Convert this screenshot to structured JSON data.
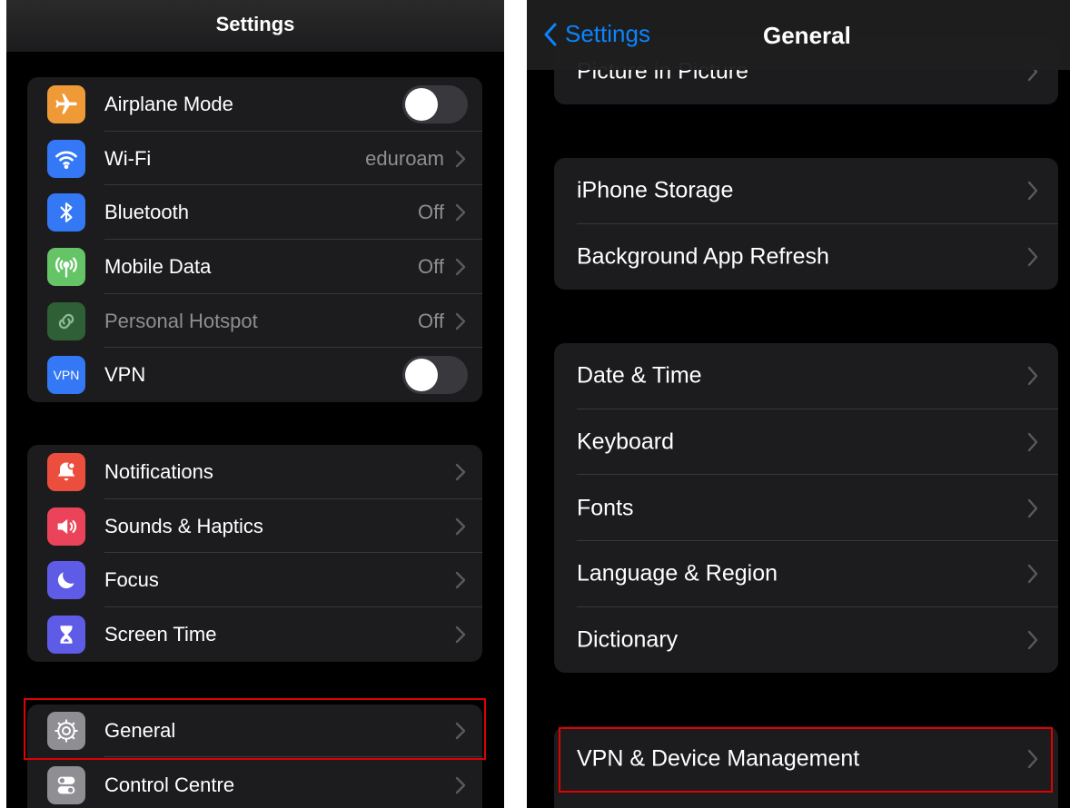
{
  "left_screen": {
    "nav": {
      "title": "Settings"
    },
    "group1": [
      {
        "label": "Airplane Mode",
        "icon": "airplane-icon",
        "icon_color": "#f09a37",
        "control": "toggle",
        "toggle_on": false
      },
      {
        "label": "Wi-Fi",
        "value": "eduroam",
        "icon": "wifi-icon",
        "icon_color": "#3478f6",
        "control": "chevron"
      },
      {
        "label": "Bluetooth",
        "value": "Off",
        "icon": "bluetooth-icon",
        "icon_color": "#3478f6",
        "control": "chevron"
      },
      {
        "label": "Mobile Data",
        "value": "Off",
        "icon": "antenna-icon",
        "icon_color": "#65c466",
        "control": "chevron"
      },
      {
        "label": "Personal Hotspot",
        "value": "Off",
        "icon": "hotspot-icon",
        "icon_color": "#2f5f35",
        "control": "chevron",
        "dimmed": true
      },
      {
        "label": "VPN",
        "icon": "vpn-icon",
        "icon_text": "VPN",
        "icon_color": "#3478f6",
        "control": "toggle",
        "toggle_on": false
      }
    ],
    "group2": [
      {
        "label": "Notifications",
        "icon": "bell-icon",
        "icon_color": "#eb4e3d"
      },
      {
        "label": "Sounds & Haptics",
        "icon": "speaker-icon",
        "icon_color": "#eb445a"
      },
      {
        "label": "Focus",
        "icon": "moon-icon",
        "icon_color": "#5e5ce6"
      },
      {
        "label": "Screen Time",
        "icon": "hourglass-icon",
        "icon_color": "#5e5ce6"
      }
    ],
    "group3": [
      {
        "label": "General",
        "icon": "gear-icon",
        "icon_color": "#8e8e93",
        "highlighted": true
      },
      {
        "label": "Control Centre",
        "icon": "switches-icon",
        "icon_color": "#8e8e93"
      }
    ]
  },
  "right_screen": {
    "nav": {
      "back_label": "Settings",
      "title": "General"
    },
    "group0": [
      {
        "label": "Picture in Picture"
      }
    ],
    "group1": [
      {
        "label": "iPhone Storage"
      },
      {
        "label": "Background App Refresh"
      }
    ],
    "group2": [
      {
        "label": "Date & Time"
      },
      {
        "label": "Keyboard"
      },
      {
        "label": "Fonts"
      },
      {
        "label": "Language & Region"
      },
      {
        "label": "Dictionary"
      }
    ],
    "group3": [
      {
        "label": "VPN & Device Management",
        "highlighted": true
      }
    ]
  },
  "colors": {
    "accent": "#0a84ff",
    "highlight_border": "#e00000",
    "cell_background": "#1c1c1e",
    "secondary_text": "#8e8e93"
  }
}
